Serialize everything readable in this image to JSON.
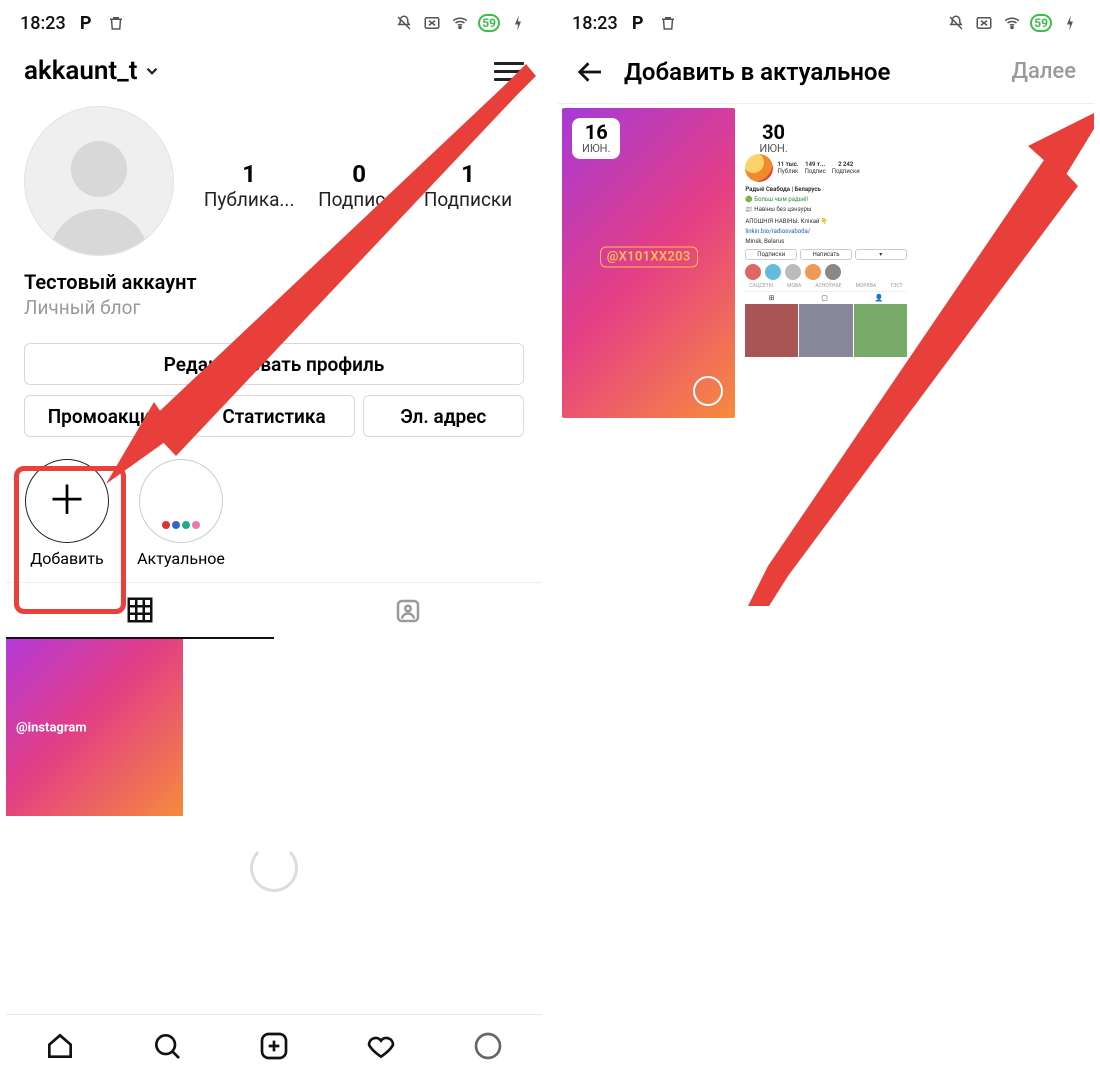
{
  "status": {
    "time": "18:23",
    "battery": "59"
  },
  "screen1": {
    "username": "akkaunt_t",
    "stats": {
      "posts": {
        "value": "1",
        "label": "Публика..."
      },
      "followers": {
        "value": "0",
        "label": "Подпис..."
      },
      "following": {
        "value": "1",
        "label": "Подписки"
      }
    },
    "display_name": "Тестовый аккаунт",
    "category": "Личный блог",
    "buttons": {
      "edit_profile": "Редактировать профиль",
      "promos": "Промоакции",
      "stats": "Статистика",
      "email": "Эл. адрес"
    },
    "highlights": {
      "add_label": "Добавить",
      "existing_label": "Актуальное"
    },
    "post_tag": "@instagram"
  },
  "screen2": {
    "title": "Добавить в актуальное",
    "next": "Далее",
    "story1": {
      "day": "16",
      "month": "ИЮН.",
      "mention": "@X101XX203"
    },
    "story2": {
      "day": "30",
      "month": "ИЮН.",
      "profile": {
        "posts": "11 тыс.",
        "followers": "149 т...",
        "following": "2 242",
        "name": "Радыё Свабода | Беларусь",
        "tagline": "Больш чым радыё!",
        "sub": "Навіны без цэнзуры",
        "link": "linkin.bio/radiosvaboda/",
        "location": "Minsk, Belarus",
        "btn_follow": "Подписки",
        "btn_msg": "Написать",
        "hl": [
          "САЦСЕТКІ",
          "МОВА",
          "АСНОЎНАЕ",
          "МОРКВА",
          "ТЭСТ"
        ]
      }
    }
  }
}
